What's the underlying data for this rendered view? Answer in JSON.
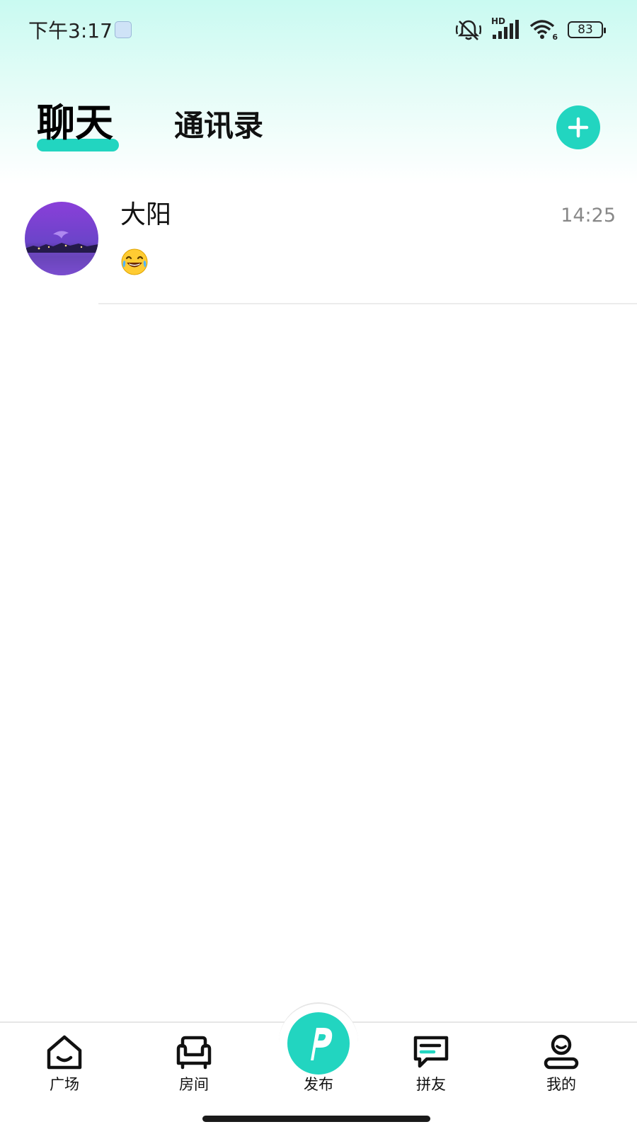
{
  "status_bar": {
    "time": "下午3:17",
    "battery": "83",
    "network_label": "HD",
    "wifi_badge": "6"
  },
  "header": {
    "tabs": [
      {
        "label": "聊天",
        "active": true
      },
      {
        "label": "通讯录",
        "active": false
      }
    ],
    "add_icon": "plus-icon"
  },
  "chats": [
    {
      "name": "大阳",
      "time": "14:25",
      "preview_icon": "laughing-tears-emoji"
    }
  ],
  "bottom_nav": {
    "items": [
      {
        "label": "广场",
        "icon": "home-icon"
      },
      {
        "label": "房间",
        "icon": "sofa-icon"
      },
      {
        "label": "发布",
        "icon": "publish-p-icon"
      },
      {
        "label": "拼友",
        "icon": "chat-bubble-icon"
      },
      {
        "label": "我的",
        "icon": "profile-icon"
      }
    ]
  },
  "colors": {
    "accent": "#22d5c0",
    "header_gradient_top": "#c9faf1",
    "text_primary": "#111111",
    "text_secondary": "#888888"
  }
}
